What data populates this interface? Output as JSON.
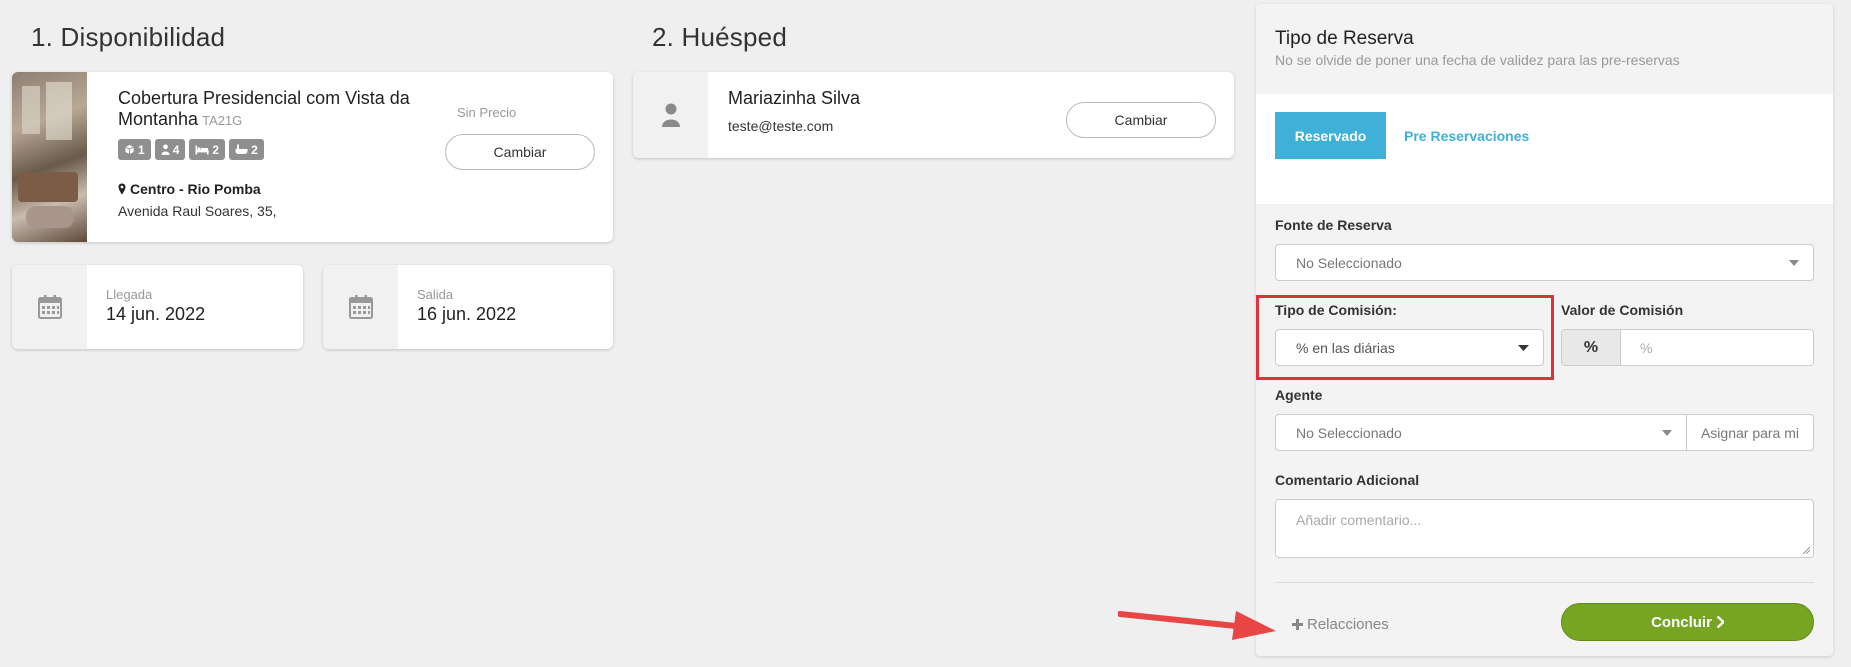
{
  "sections": {
    "availability_title": "1. Disponibilidad",
    "guest_title": "2. Huésped"
  },
  "property": {
    "name": "Cobertura Presidencial com Vista da Montanha",
    "code": "TA21G",
    "badges": [
      {
        "icon": "cube-icon",
        "value": "1"
      },
      {
        "icon": "person-icon",
        "value": "4"
      },
      {
        "icon": "bed-icon",
        "value": "2"
      },
      {
        "icon": "bath-icon",
        "value": "2"
      }
    ],
    "location": "Centro - Rio Pomba",
    "address": "Avenida Raul Soares, 35,",
    "price_label": "Sin Precio",
    "change_label": "Cambiar"
  },
  "dates": {
    "arrival_label": "Llegada",
    "arrival_value": "14 jun. 2022",
    "departure_label": "Salida",
    "departure_value": "16 jun. 2022"
  },
  "guest": {
    "name": "Mariazinha Silva",
    "email": "teste@teste.com",
    "change_label": "Cambiar"
  },
  "panel": {
    "title": "Tipo de Reserva",
    "subtitle": "No se olvide de poner una fecha de validez para las pre-reservas",
    "tabs": [
      {
        "label": "Reservado",
        "active": true
      },
      {
        "label": "Pre Reservaciones",
        "active": false
      }
    ],
    "source_label": "Fonte de Reserva",
    "source_value": "No Seleccionado",
    "commission_type_label": "Tipo de Comisión:",
    "commission_type_value": "% en las diárias",
    "commission_value_label": "Valor de Comisión",
    "commission_addon": "%",
    "commission_placeholder": "%",
    "agent_label": "Agente",
    "agent_value": "No Seleccionado",
    "assign_label": "Asignar para mi",
    "comment_label": "Comentario Adicional",
    "comment_placeholder": "Añadir comentario...",
    "relations_label": "Relacciones",
    "conclude_label": "Concluir"
  },
  "colors": {
    "accent_blue": "#3fb1d8",
    "conclude_green": "#76a524",
    "highlight_red": "#e0313a",
    "annotation_arrow": "#e84545"
  }
}
